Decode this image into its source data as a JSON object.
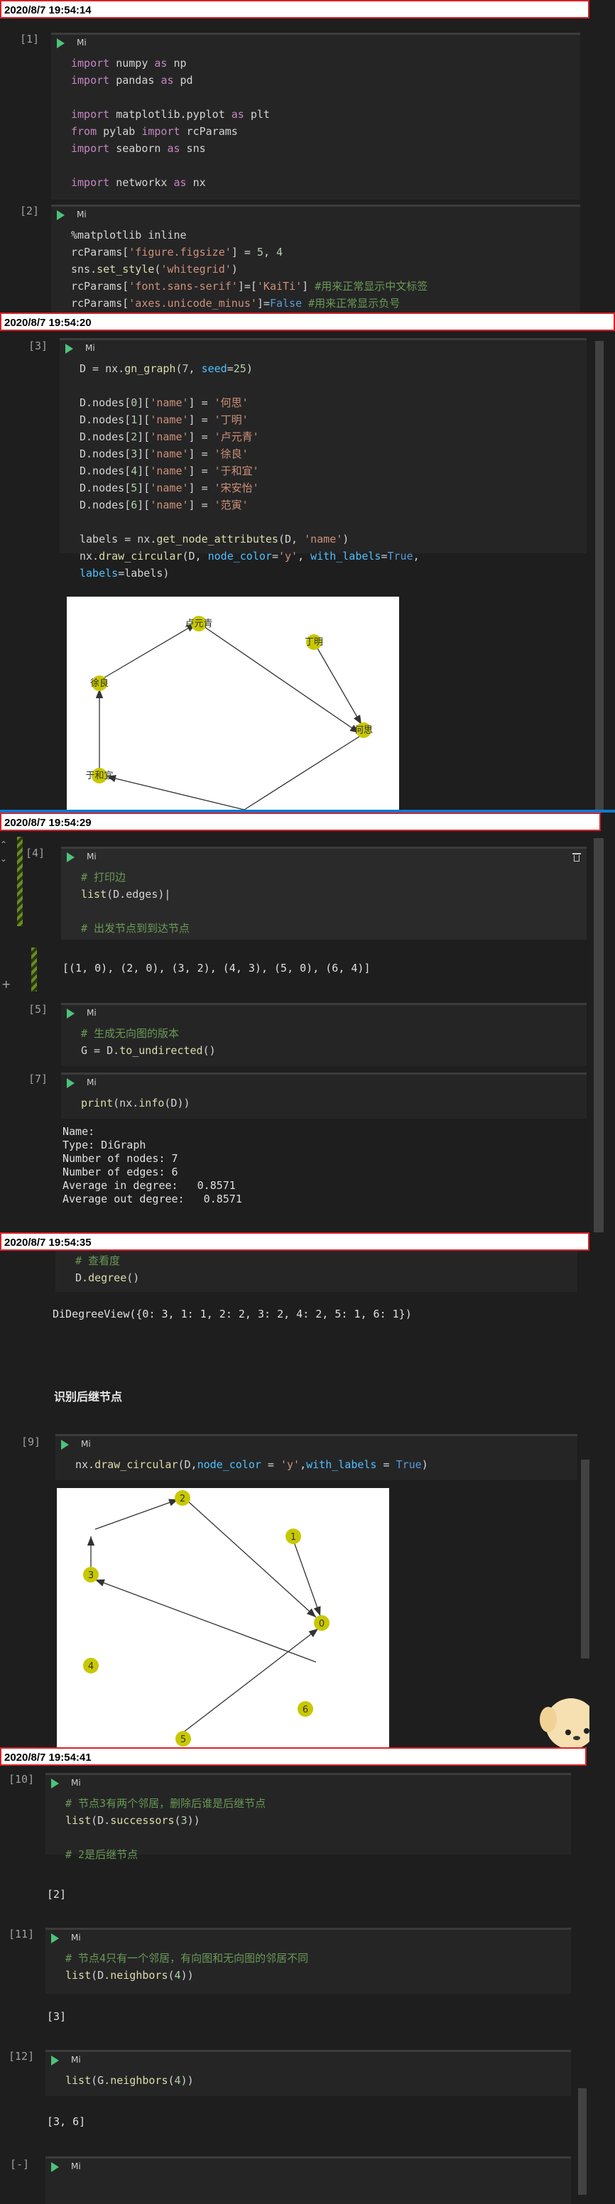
{
  "timestamps": [
    "2020/8/7 19:54:14",
    "2020/8/7 19:54:20",
    "2020/8/7 19:54:29",
    "2020/8/7 19:54:35",
    "2020/8/7 19:54:41"
  ],
  "kernel_label": "Mi",
  "cells": {
    "c1": {
      "prompt": "[1]"
    },
    "c2": {
      "prompt": "[2]"
    },
    "c3": {
      "prompt": "[3]"
    },
    "c4": {
      "prompt": "[4]",
      "output": "[(1, 0), (2, 0), (3, 2), (4, 3), (5, 0), (6, 4)]"
    },
    "c5": {
      "prompt": "[5]"
    },
    "c7": {
      "prompt": "[7]",
      "output": "Name:\nType: DiGraph\nNumber of nodes: 7\nNumber of edges: 6\nAverage in degree:   0.8571\nAverage out degree:   0.8571"
    },
    "c8": {
      "output": "DiDegreeView({0: 3, 1: 1, 2: 2, 3: 2, 4: 2, 5: 1, 6: 1})"
    },
    "md": {
      "text": "识别后继节点"
    },
    "c9": {
      "prompt": "[9]"
    },
    "c10": {
      "prompt": "[10]",
      "output": "[2]"
    },
    "c11": {
      "prompt": "[11]",
      "output": "[3]"
    },
    "c12": {
      "prompt": "[12]",
      "output": "[3, 6]"
    },
    "c13": {
      "prompt": "[-]"
    }
  },
  "graph_names": {
    "0": "何思",
    "1": "丁明",
    "2": "卢元青",
    "3": "徐良",
    "4": "于和宜",
    "5": "宋安怡",
    "6": "范寅"
  },
  "graph_numbers": {
    "0": "0",
    "1": "1",
    "2": "2",
    "3": "3",
    "4": "4",
    "5": "5",
    "6": "6"
  },
  "colors": {
    "node": "#c8c800",
    "accent_green": "#4ec27a",
    "timestamp_border": "#d9222a"
  }
}
